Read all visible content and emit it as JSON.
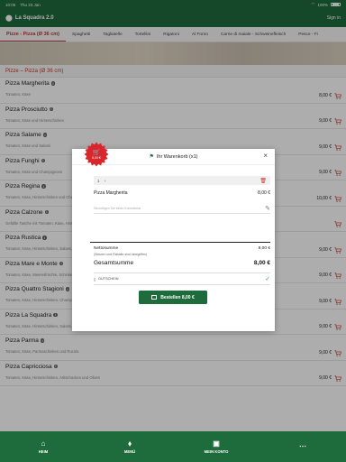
{
  "status_bar": {
    "time": "10:05",
    "date": "Thu 23 Jan",
    "battery": "100%"
  },
  "header": {
    "title": "La Squadra 2.0",
    "login": "Sign in"
  },
  "categories": [
    "Pizze - Pizza (Ø 36 cm)",
    "Spaghetti",
    "Tagliatelle",
    "Tortellini",
    "Rigatoni",
    "Al Forno",
    "Carne di maiale - Schweinefleisch",
    "Pesce - Fi"
  ],
  "section_title": "Pizze – Pizza (Ø 36 cm)",
  "menu_items": [
    {
      "name": "Pizza Margherita",
      "desc": "Tomaten, Käse",
      "price": "8,00 €"
    },
    {
      "name": "Pizza Prosciutto",
      "desc": "Tomaten, Käse und Hinterschinken",
      "price": "9,00 €"
    },
    {
      "name": "Pizza Salame",
      "desc": "Tomaten, Käse und Salami",
      "price": "9,00 €"
    },
    {
      "name": "Pizza Funghi",
      "desc": "Tomaten, Käse und Champignons",
      "price": "9,00 €"
    },
    {
      "name": "Pizza Regina",
      "desc": "Tomaten, Käse, Hinterschinken und Champignons",
      "price": "10,00 €"
    },
    {
      "name": "Pizza Calzone",
      "desc": "Gefüllte Tasche mit Tomaten, Käse, Hinterschinken, Champignons und Salami",
      "price": ""
    },
    {
      "name": "Pizza Rustica",
      "desc": "Tomaten, Käse, Hinterschinken, Salami, Champignons",
      "price": "9,00 €"
    },
    {
      "name": "Pizza Mare e Monte",
      "desc": "Tomaten, Käse, Meeresfrüchte, Schinken und Champignons",
      "price": "9,00 €"
    },
    {
      "name": "Pizza Quattro Stagioni",
      "desc": "Tomaten, Käse, Hinterschinken, Champignons, Salami, Artischocken",
      "price": "9,00 €"
    },
    {
      "name": "Pizza La Squadra",
      "desc": "Tomaten, Käse, Hinterschinken, Salami, Champignons, Peperoni, Artischocken, Oliven und Paprika",
      "price": "9,00 €"
    },
    {
      "name": "Pizza Parma",
      "desc": "Tomaten, Käse, Parmaschinken und Rucola",
      "price": "9,00 €"
    },
    {
      "name": "Pizza Capricciosa",
      "desc": "Tomaten, Käse, Hinterschinken, Artischocken und Oliven",
      "price": "9,00 €"
    }
  ],
  "cart_modal": {
    "title": "Ihr Warenkorb (x1)",
    "close": "×",
    "quantity": "1",
    "item_name": "Pizza Margherita",
    "item_price": "8,00 €",
    "comment_placeholder": "Hinzufügen Sie einen Kommentar",
    "net_label": "Nettosumme",
    "net_value": "8,00 €",
    "tax_note": "(Steuern und Rabatte sind inbegriffen)",
    "total_label": "Gesamtsumme",
    "total_value": "8,00 €",
    "voucher_label": "GUTSCHEIN",
    "order_button": "Bestellen 8,00 €"
  },
  "badge": {
    "amount": "8,00 €"
  },
  "bottom_nav": [
    {
      "label": "HEIM",
      "icon": "home-icon"
    },
    {
      "label": "MENÜ",
      "icon": "tag-icon"
    },
    {
      "label": "MEIN KONTO",
      "icon": "account-icon"
    },
    {
      "label": "",
      "icon": "more-icon"
    }
  ],
  "colors": {
    "brand_green": "#1e6b3c",
    "accent_red": "#c0392b",
    "badge_red": "#d9262c"
  }
}
